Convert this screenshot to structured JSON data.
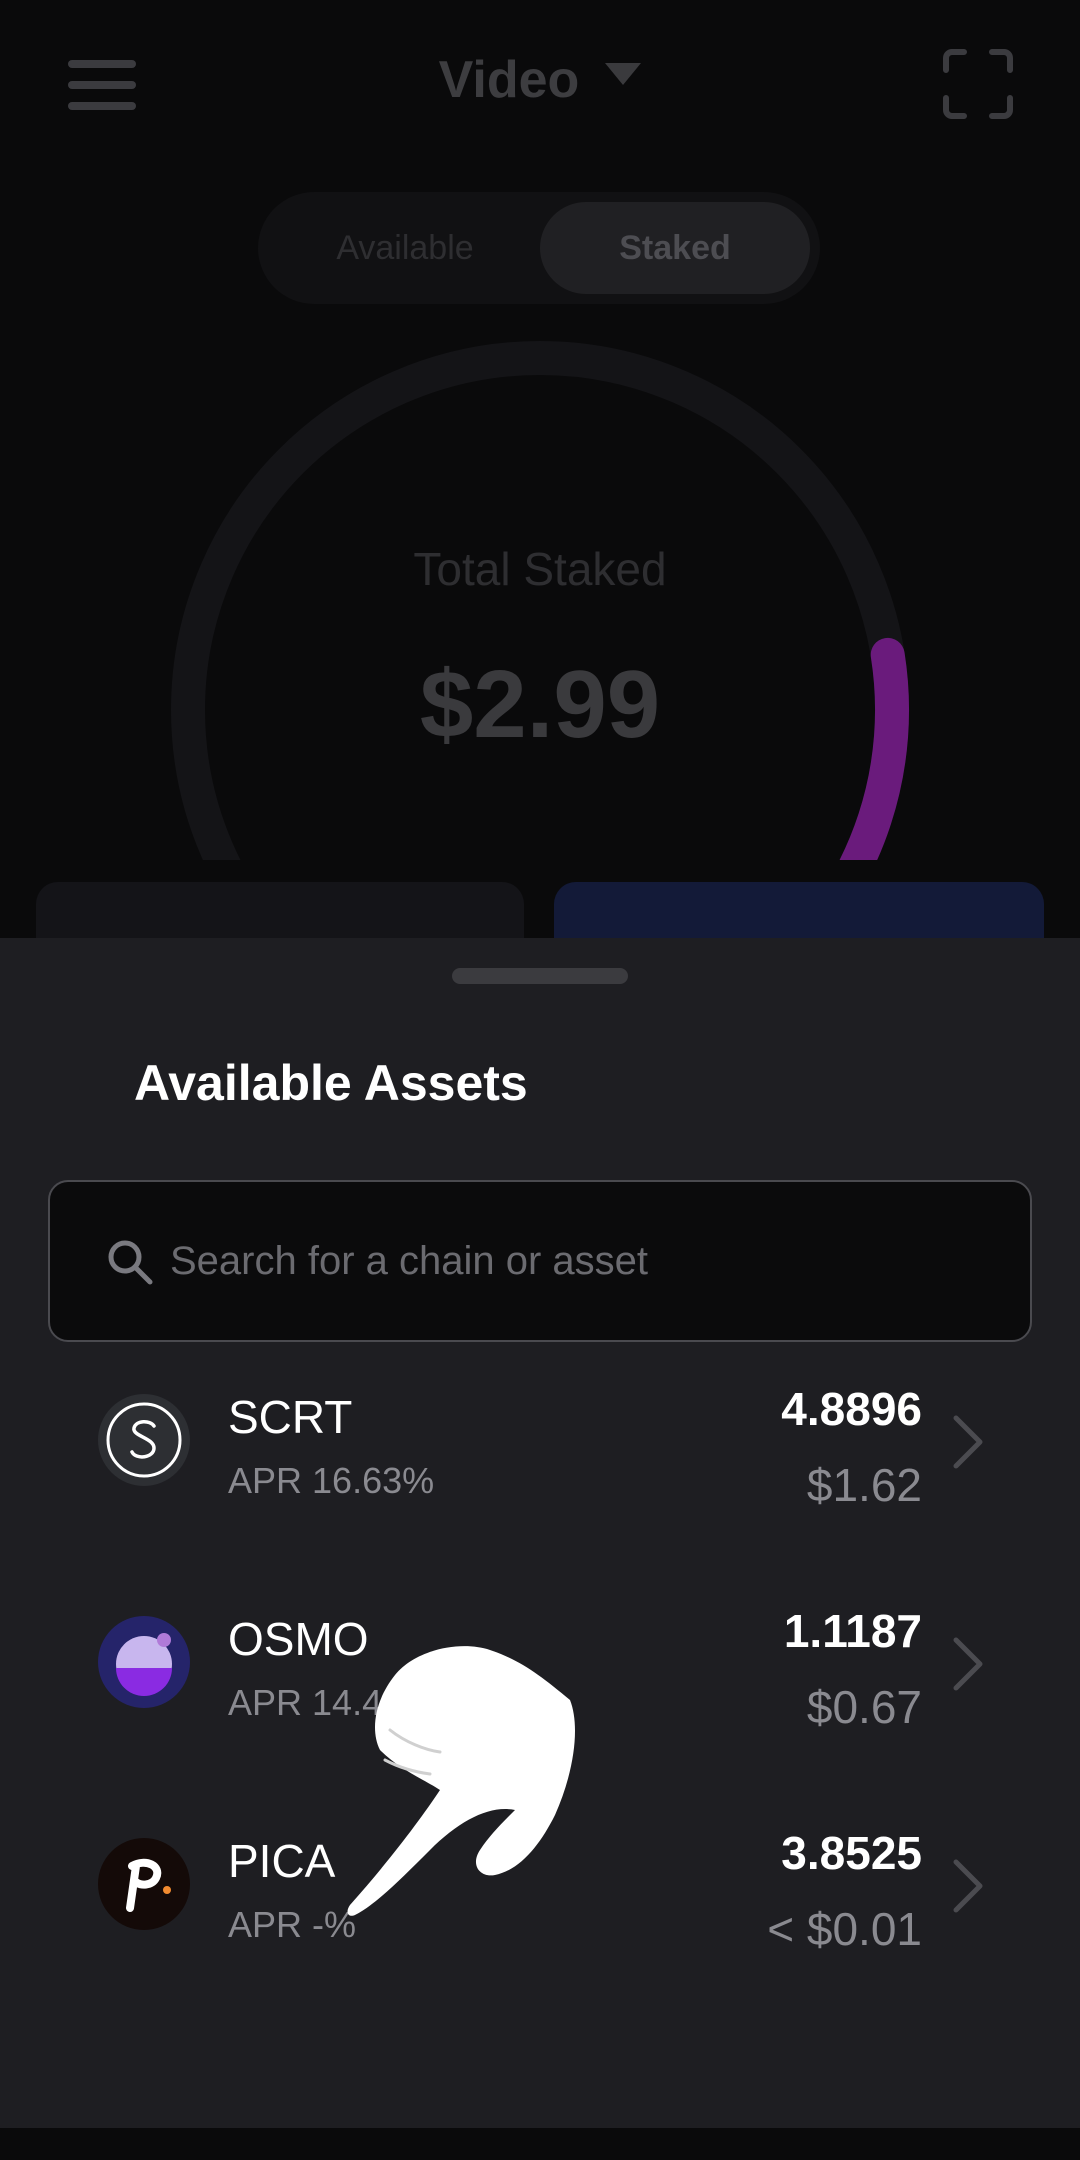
{
  "header": {
    "title": "Video"
  },
  "toggle": {
    "available_label": "Available",
    "staked_label": "Staked",
    "selected": "Staked"
  },
  "gauge": {
    "label": "Total Staked",
    "value": "$2.99",
    "fill_fraction": 0.2,
    "fill_color": "#6a1b7c"
  },
  "sheet": {
    "title": "Available Assets",
    "search_placeholder": "Search for a chain or asset",
    "assets": [
      {
        "symbol": "SCRT",
        "apr": "APR 16.63%",
        "amount": "4.8896",
        "value": "$1.62",
        "icon": "scrt-logo-icon"
      },
      {
        "symbol": "OSMO",
        "apr": "APR 14.4",
        "amount": "1.1187",
        "value": "$0.67",
        "icon": "osmo-logo-icon"
      },
      {
        "symbol": "PICA",
        "apr": "APR -%",
        "amount": "3.8525",
        "value": "< $0.01",
        "icon": "pica-logo-icon"
      }
    ]
  },
  "colors": {
    "background": "#0a0a0b",
    "sheet": "#1e1e22",
    "accent_purple": "#6a1b7c",
    "accent_blue": "#131a38"
  }
}
